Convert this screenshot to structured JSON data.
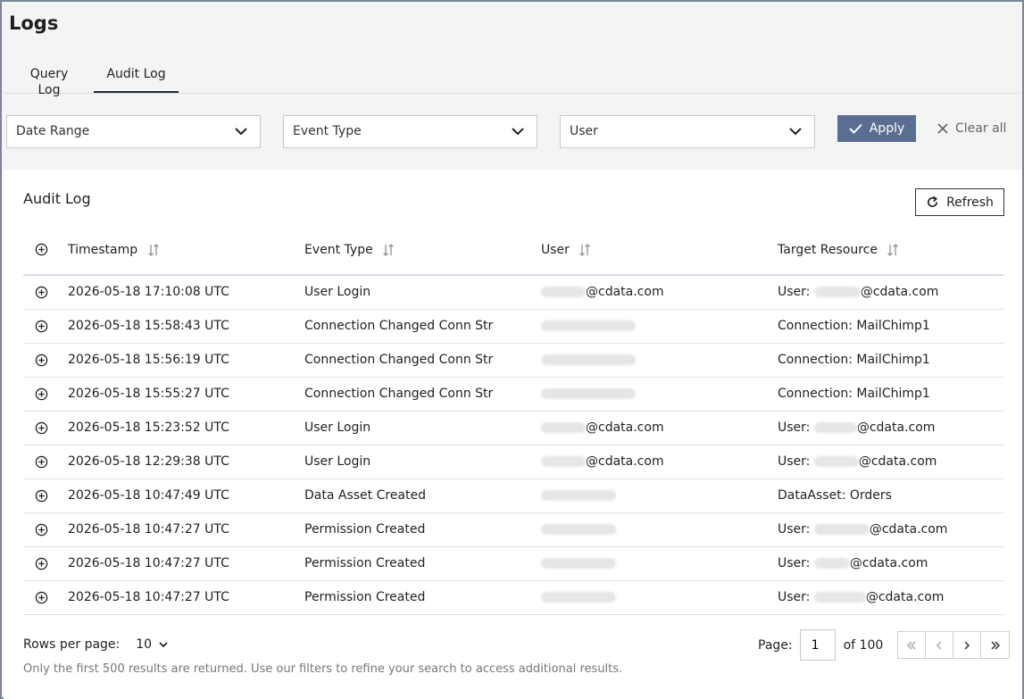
{
  "page": {
    "title": "Logs"
  },
  "tabs": [
    {
      "label": "Query Log",
      "active": false
    },
    {
      "label": "Audit Log",
      "active": true
    }
  ],
  "filters": {
    "date_range": "Date Range",
    "event_type": "Event Type",
    "user": "User",
    "apply_label": "Apply",
    "clear_label": "Clear all"
  },
  "card": {
    "title": "Audit Log",
    "refresh_label": "Refresh"
  },
  "table": {
    "columns": [
      "Timestamp",
      "Event Type",
      "User",
      "Target Resource"
    ],
    "rows": [
      {
        "timestamp": "2026-05-18 17:10:08 UTC",
        "event": "User Login",
        "user_suffix": "@cdata.com",
        "target_prefix": "User: ",
        "target_suffix": "@cdata.com"
      },
      {
        "timestamp": "2026-05-18 15:58:43 UTC",
        "event": "Connection Changed Conn Str",
        "user_suffix": "",
        "target_prefix": "Connection: MailChimp1",
        "target_suffix": ""
      },
      {
        "timestamp": "2026-05-18 15:56:19 UTC",
        "event": "Connection Changed Conn Str",
        "user_suffix": "",
        "target_prefix": "Connection: MailChimp1",
        "target_suffix": ""
      },
      {
        "timestamp": "2026-05-18 15:55:27 UTC",
        "event": "Connection Changed Conn Str",
        "user_suffix": "",
        "target_prefix": "Connection: MailChimp1",
        "target_suffix": ""
      },
      {
        "timestamp": "2026-05-18 15:23:52 UTC",
        "event": "User Login",
        "user_suffix": "@cdata.com",
        "target_prefix": "User: ",
        "target_suffix": "@cdata.com"
      },
      {
        "timestamp": "2026-05-18 12:29:38 UTC",
        "event": "User Login",
        "user_suffix": "@cdata.com",
        "target_prefix": "User: ",
        "target_suffix": "@cdata.com"
      },
      {
        "timestamp": "2026-05-18 10:47:49 UTC",
        "event": "Data Asset Created",
        "user_suffix": "",
        "target_prefix": "DataAsset: Orders",
        "target_suffix": ""
      },
      {
        "timestamp": "2026-05-18 10:47:27 UTC",
        "event": "Permission Created",
        "user_suffix": "",
        "target_prefix": "User: ",
        "target_suffix": "@cdata.com"
      },
      {
        "timestamp": "2026-05-18 10:47:27 UTC",
        "event": "Permission Created",
        "user_suffix": "",
        "target_prefix": "User: ",
        "target_suffix": "@cdata.com"
      },
      {
        "timestamp": "2026-05-18 10:47:27 UTC",
        "event": "Permission Created",
        "user_suffix": "",
        "target_prefix": "User: ",
        "target_suffix": "@cdata.com"
      }
    ]
  },
  "pagination": {
    "rows_per_page_label": "Rows per page:",
    "rows_per_page_value": "10",
    "page_label": "Page:",
    "page_value": "1",
    "of_label": "of 100"
  },
  "footnote": "Only the first 500 results are returned. Use our filters to refine your search to access additional results."
}
